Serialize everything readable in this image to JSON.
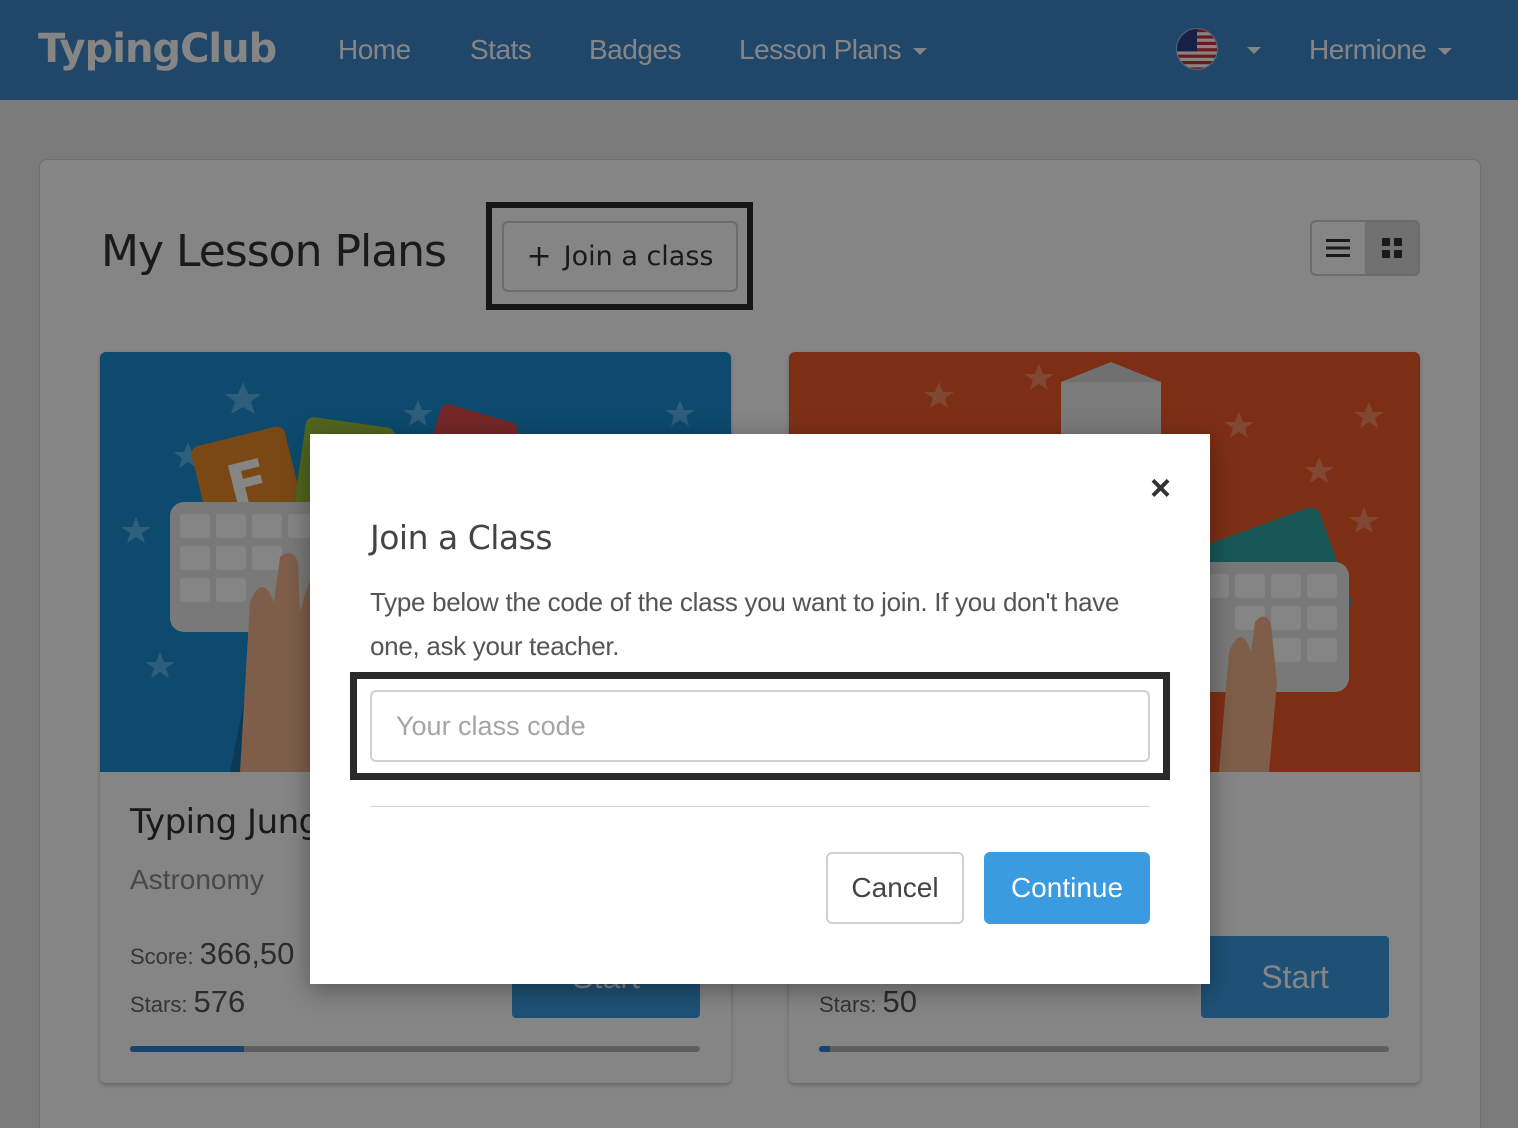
{
  "nav": {
    "brand": "TypingClub",
    "items": [
      {
        "label": "Home"
      },
      {
        "label": "Stats"
      },
      {
        "label": "Badges"
      },
      {
        "label": "Lesson Plans"
      }
    ],
    "language_icon": "us-flag-icon",
    "user_name": "Hermione"
  },
  "page": {
    "title": "My Lesson Plans",
    "join_button_label": "Join a class",
    "view_icons": [
      "list-view-icon",
      "grid-view-icon"
    ]
  },
  "lesson_cards": [
    {
      "title": "Typing Jung",
      "subtitle": "Astronomy",
      "score_label": "Score:",
      "score_value": "366,50",
      "stars_label": "Stars:",
      "stars_value": "576",
      "start_label": "Start",
      "progress_fraction": 0.2
    },
    {
      "stars_label": "Stars:",
      "stars_value": "50",
      "start_label": "Start",
      "progress_fraction": 0.02
    }
  ],
  "modal": {
    "title": "Join a Class",
    "description": "Type below the code of the class you want to join. If you don't have one, ask your teacher.",
    "input_placeholder": "Your class code",
    "input_value": "",
    "cancel_label": "Cancel",
    "continue_label": "Continue",
    "close_glyph": "×"
  },
  "colors": {
    "nav_bg": "#3e87c9",
    "primary_button": "#3a9be0",
    "card1_art": "#1a8fd3",
    "card2_art": "#f05a2b"
  }
}
